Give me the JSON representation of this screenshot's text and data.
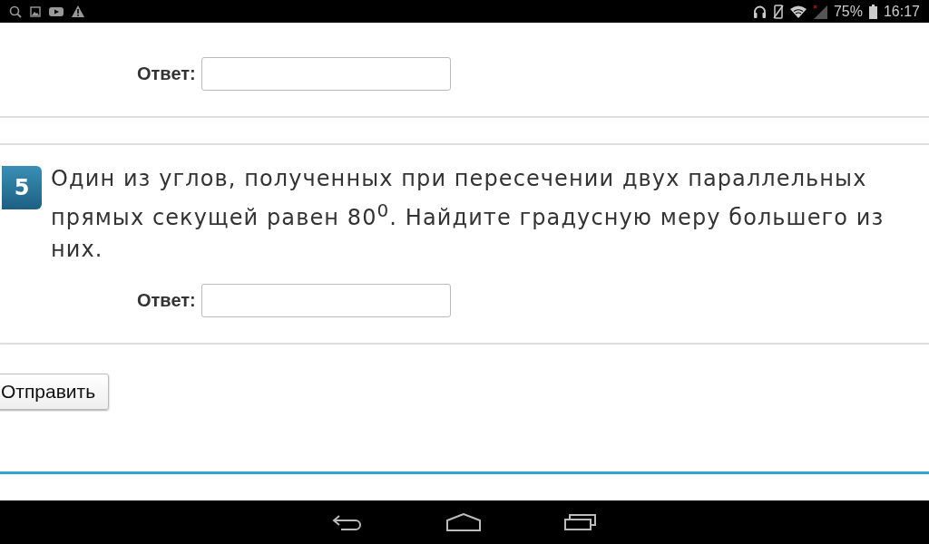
{
  "status_bar": {
    "battery": "75%",
    "time": "16:17"
  },
  "questions": [
    {
      "answer_label": "Ответ:"
    },
    {
      "number": "5",
      "text": "Один из углов, полученных при пересечении двух параллельных прямых секущей равен 80$^{0}$. Найдите градусную меру большего из них.",
      "answer_label": "Ответ:"
    }
  ],
  "submit_button": "Отправить"
}
